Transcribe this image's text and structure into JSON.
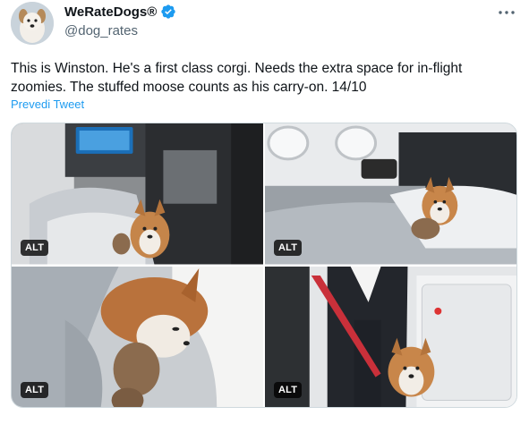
{
  "author": {
    "display_name": "WeRateDogs®",
    "handle": "@dog_rates",
    "verified_color": "#1d9bf0"
  },
  "tweet": {
    "text": "This is Winston. He's a first class corgi. Needs the extra space for in-flight zoomies. The stuffed moose counts as his carry-on. 14/10",
    "translate_label": "Prevedi Tweet"
  },
  "media": [
    {
      "alt_label": "ALT"
    },
    {
      "alt_label": "ALT"
    },
    {
      "alt_label": "ALT"
    },
    {
      "alt_label": "ALT"
    }
  ],
  "icons": {
    "verified": "verified-badge-icon",
    "more": "more-options-icon"
  },
  "colors": {
    "link": "#1d9bf0",
    "secondary_text": "#536471",
    "primary_text": "#0f1419"
  }
}
